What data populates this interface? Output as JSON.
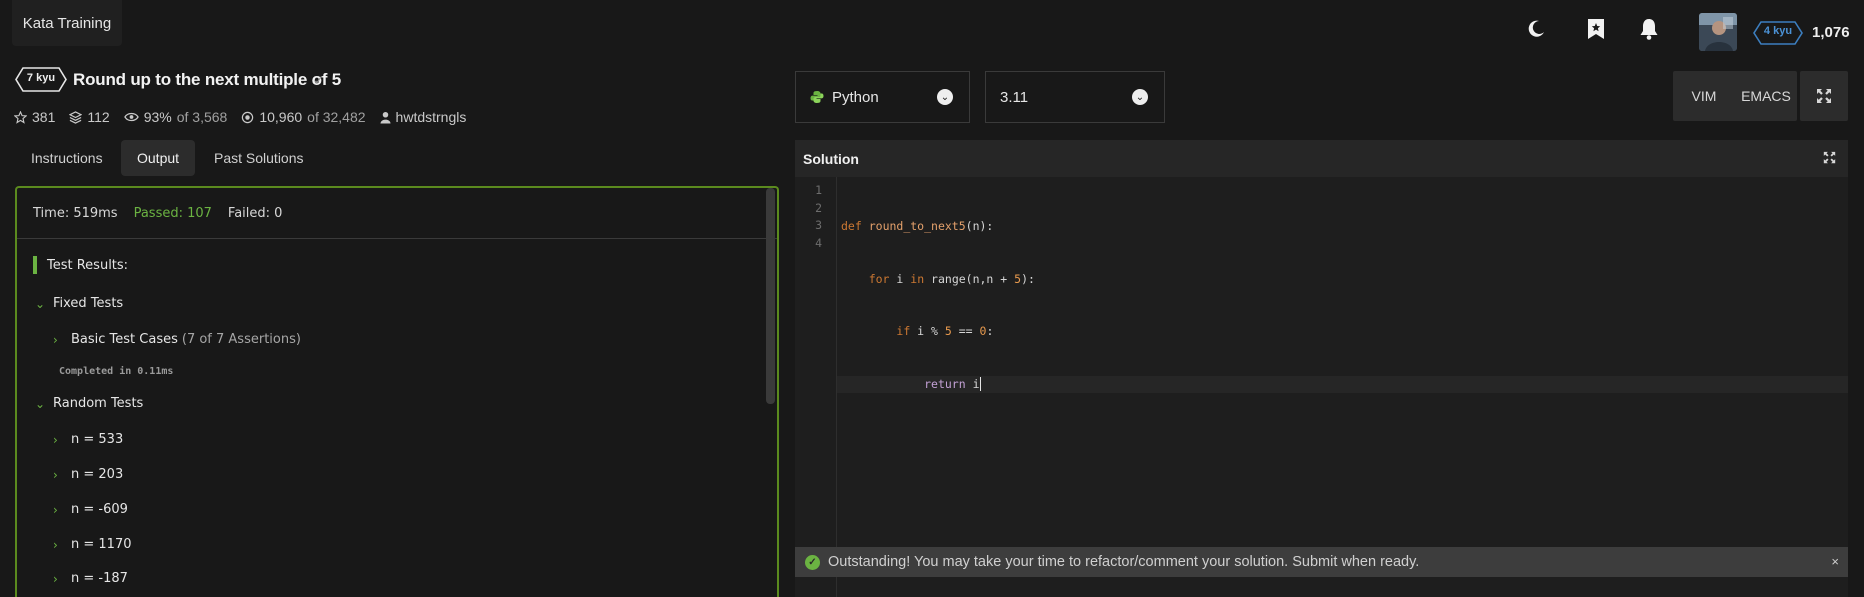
{
  "app": {
    "brand": "Kata Training"
  },
  "topbar": {
    "icons": [
      "moon-icon",
      "bookmark-icon",
      "bell-icon"
    ],
    "rank": "4 kyu",
    "honor": "1,076"
  },
  "kata": {
    "kyu": "7 kyu",
    "title": "Round up to the next multiple of 5",
    "check": "✓",
    "stats": {
      "stars": "381",
      "collections": "112",
      "satisfaction": "93%",
      "satisfaction_of": "of 3,568",
      "completions": "10,960",
      "completions_of": "of 32,482",
      "author": "hwtdstrngls"
    }
  },
  "tabs": [
    {
      "label": "Instructions"
    },
    {
      "label": "Output"
    },
    {
      "label": "Past Solutions"
    }
  ],
  "output": {
    "time": "Time: 519ms",
    "passed": "Passed: 107",
    "failed": "Failed: 0",
    "results_heading": "Test Results:",
    "fixed_tests": "Fixed Tests",
    "basic_cases": "Basic Test Cases",
    "basic_assertions": "(7 of 7 Assertions)",
    "completed": "Completed in 0.11ms",
    "random_tests": "Random Tests",
    "random_cases": [
      "n = 533",
      "n = 203",
      "n = -609",
      "n = 1170",
      "n = -187"
    ]
  },
  "editor_toolbar": {
    "language": "Python",
    "version": "3.11",
    "modes": [
      "VIM",
      "EMACS"
    ]
  },
  "editor": {
    "heading": "Solution",
    "line_numbers": [
      "1",
      "2",
      "3",
      "4"
    ]
  },
  "banner": {
    "message": "Outstanding! You may take your time to refactor/comment your solution. Submit when ready.",
    "close": "×"
  },
  "colors": {
    "accent_green": "#6bb342",
    "panel_border": "#5b8a1e",
    "rank_blue": "#3c7ebf",
    "background": "#181818"
  }
}
